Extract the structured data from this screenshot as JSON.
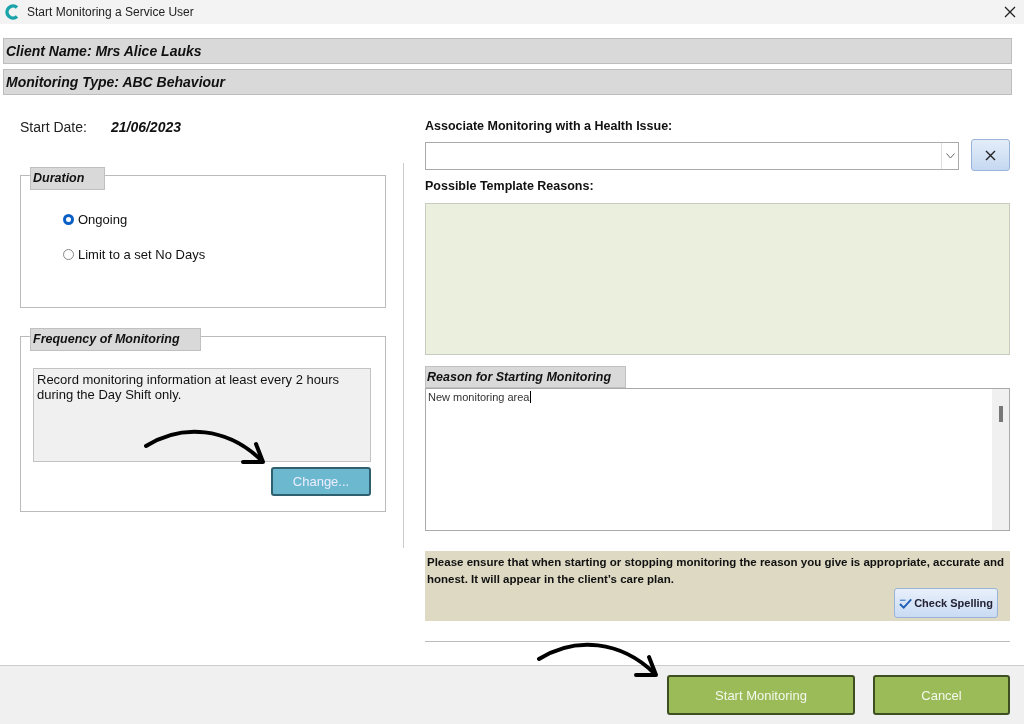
{
  "window": {
    "title": "Start Monitoring a Service User"
  },
  "header": [
    {
      "text": "Client Name: Mrs Alice Lauks"
    },
    {
      "text": "Monitoring Type: ABC Behaviour"
    }
  ],
  "start_date": {
    "label": "Start Date:",
    "value": "21/06/2023"
  },
  "duration": {
    "title": "Duration",
    "options": [
      {
        "label": "Ongoing",
        "selected": true
      },
      {
        "label": "Limit to a set No Days",
        "selected": false
      }
    ]
  },
  "frequency": {
    "title": "Frequency of Monitoring",
    "text": "Record monitoring information at least every 2 hours during the Day Shift only.",
    "button": "Change..."
  },
  "health_issue": {
    "label": "Associate Monitoring with a Health Issue:"
  },
  "template_reasons": {
    "label": "Possible Template Reasons:"
  },
  "reason": {
    "title": "Reason for Starting Monitoring",
    "value": "New monitoring area"
  },
  "notice": {
    "text": "Please ensure that when starting or stopping monitoring the reason you give is appropriate, accurate and honest. It will appear in the client’s care plan.",
    "button": "Check Spelling"
  },
  "footer": {
    "buttons": [
      "Start Monitoring",
      "Cancel"
    ]
  }
}
